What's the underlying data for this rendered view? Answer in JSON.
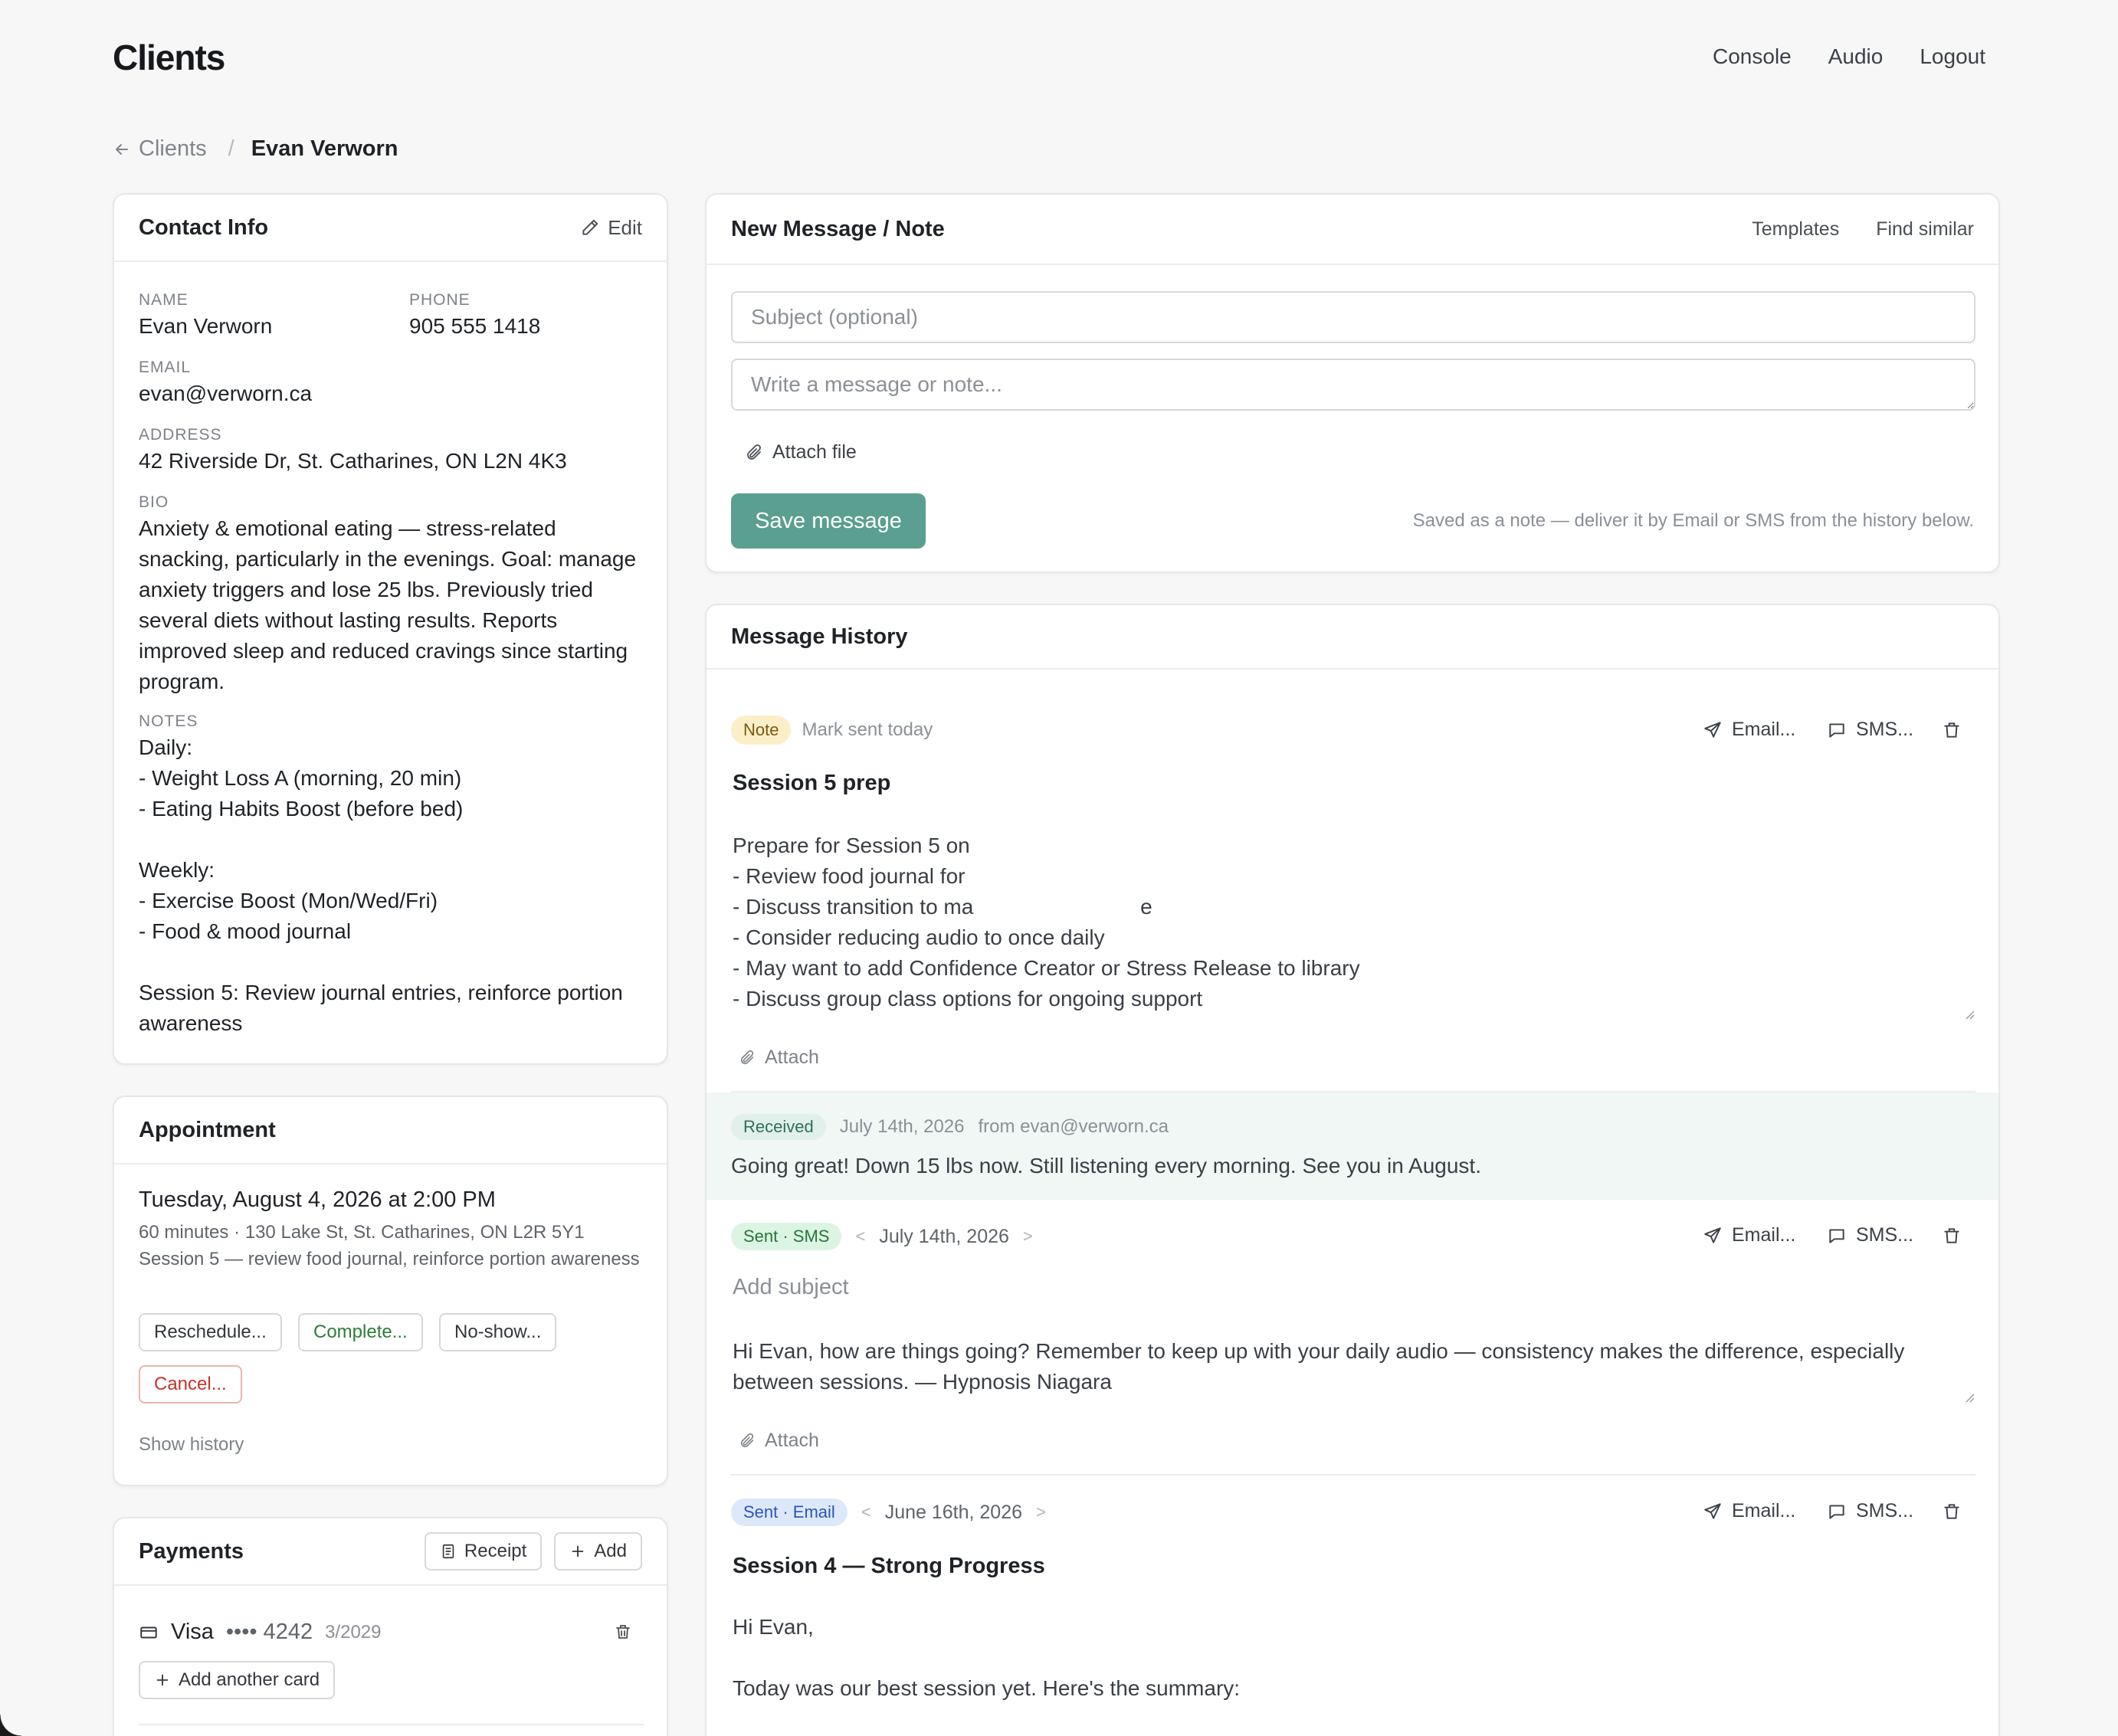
{
  "app": {
    "title": "Clients"
  },
  "topnav": {
    "console": "Console",
    "audio": "Audio",
    "logout": "Logout"
  },
  "breadcrumb": {
    "back": "Clients",
    "separator": "/",
    "current": "Evan Verworn"
  },
  "contact": {
    "title": "Contact Info",
    "edit_label": "Edit",
    "name_label": "NAME",
    "name": "Evan Verworn",
    "phone_label": "PHONE",
    "phone": "905 555 1418",
    "email_label": "EMAIL",
    "email": "evan@verworn.ca",
    "address_label": "ADDRESS",
    "address": "42 Riverside Dr, St. Catharines, ON L2N 4K3",
    "bio_label": "BIO",
    "bio": "Anxiety & emotional eating — stress-related snacking, particularly in the evenings. Goal: manage anxiety triggers and lose 25 lbs. Previously tried several diets without lasting results. Reports improved sleep and reduced cravings since starting program.",
    "notes_label": "NOTES",
    "notes": "Daily:\n- Weight Loss A (morning, 20 min)\n- Eating Habits Boost (before bed)\n\nWeekly:\n- Exercise Boost (Mon/Wed/Fri)\n- Food & mood journal\n\nSession 5: Review journal entries, reinforce portion awareness"
  },
  "appointment": {
    "title": "Appointment",
    "date": "Tuesday, August 4, 2026 at 2:00 PM",
    "meta": "60 minutes · 130 Lake St, St. Catharines, ON L2R 5Y1",
    "description": "Session 5 — review food journal, reinforce portion awareness",
    "reschedule": "Reschedule...",
    "complete": "Complete...",
    "noshow": "No-show...",
    "cancel": "Cancel...",
    "show_history": "Show history"
  },
  "payments": {
    "title": "Payments",
    "receipt": "Receipt",
    "add": "Add",
    "card_brand": "Visa",
    "card_mask": "•••• 4242",
    "card_expiry": "3/2029",
    "add_card": "Add another card"
  },
  "compose": {
    "title": "New Message / Note",
    "templates": "Templates",
    "find_similar": "Find similar",
    "subject_placeholder": "Subject (optional)",
    "body_placeholder": "Write a message or note...",
    "attach": "Attach file",
    "save": "Save message",
    "hint": "Saved as a note — deliver it by Email or SMS from the history below."
  },
  "history": {
    "title": "Message History",
    "email_action": "Email...",
    "sms_action": "SMS...",
    "attach": "Attach",
    "messages": [
      {
        "badge": "Note",
        "meta": "Mark sent today",
        "subject": "Session 5 prep",
        "body": "Prepare for Session 5 on\n- Review food journal for\n- Discuss transition to ma                            e\n- Consider reducing audio to once daily\n- May want to add Confidence Creator or Stress Release to library\n- Discuss group class options for ongoing support"
      },
      {
        "badge": "Received",
        "date": "July 14th, 2026",
        "from": "from evan@verworn.ca",
        "body": "Going great! Down 15 lbs now. Still listening every morning. See you in August."
      },
      {
        "badge": "Sent · SMS",
        "prev": "<",
        "date": "July 14th, 2026",
        "next": ">",
        "subject_placeholder": "Add subject",
        "body": "Hi Evan, how are things going? Remember to keep up with your daily audio — consistency makes the difference, especially between sessions. — Hypnosis Niagara"
      },
      {
        "badge": "Sent · Email",
        "prev": "<",
        "date": "June 16th, 2026",
        "next": ">",
        "subject": "Session 4 — Strong Progress",
        "body": "Hi Evan,\n\nToday was our best session yet. Here's the summary:"
      }
    ]
  },
  "colors": {
    "accent": "#5a9f8f",
    "note_badge_bg": "#fcefc7",
    "received_badge_bg": "#e1f0ea",
    "sms_badge_bg": "#dcf5e3",
    "email_badge_bg": "#dde8fb",
    "received_row_bg": "#f0f7f4"
  }
}
